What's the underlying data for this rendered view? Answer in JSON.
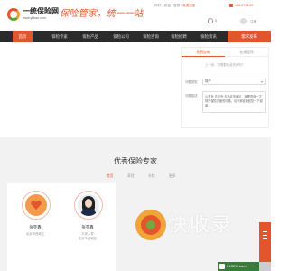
{
  "header": {
    "logo_name": "一统保险网",
    "logo_url": "www.yitbao.com",
    "slogan": "保险管家，统一一站",
    "top_links": [
      "你好，欢迎",
      "登录",
      "免费注册"
    ],
    "top_link_highlight": "免费注册",
    "hotline": "400-0775-00",
    "bell_count": "0",
    "user_link": "注册"
  },
  "nav": {
    "items": [
      "首页",
      "保险专家",
      "保险产品",
      "保险公司",
      "保险咨询",
      "保险招聘",
      "保险资讯"
    ],
    "cta": "需求发布"
  },
  "consult_form": {
    "tabs": [
      "免费咨询",
      "在线提问"
    ],
    "hint": "上一条，您需要免费咨询吗？",
    "type_label": "问题类型",
    "type_value": "财产",
    "content_label": "问题描述",
    "content_value": "山东省·青岛市·青岛区市南区，我要咨询一下财产保险方面的问题，请专家给我回复一下谢谢..."
  },
  "experts": {
    "title": "优秀保险专家",
    "filters": [
      "首页",
      "寿险",
      "车险",
      "更多"
    ],
    "cards": [
      {
        "name": "张亚鑫",
        "meta": [
          "北京市西城区"
        ]
      },
      {
        "name": "张亚鑫",
        "meta": [
          "平安人寿",
          "北京市西城区"
        ]
      }
    ]
  },
  "watermark": "快收录",
  "footer_badge": "51SEO.com",
  "colors": {
    "accent": "#e3552b",
    "nav_bg": "#2b2b2b",
    "section_bg": "#f2f2f2"
  }
}
